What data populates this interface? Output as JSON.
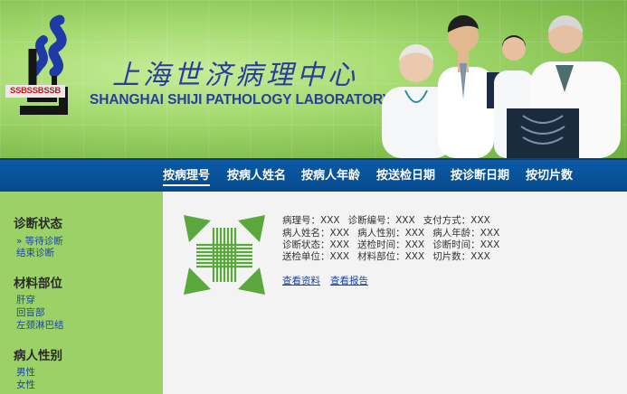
{
  "banner": {
    "logo_text": "SSBSSBSSB",
    "title_cn": "上海世济病理中心",
    "title_en": "SHANGHAI SHIJI PATHOLOGY LABORATORY"
  },
  "nav": {
    "items": [
      "按病理号",
      "按病人姓名",
      "按病人年龄",
      "按送检日期",
      "按诊断日期",
      "按切片数"
    ],
    "active": "按病理号"
  },
  "sidebar": {
    "sections": [
      {
        "heading": "诊断状态",
        "items": [
          "» 等待诊断",
          "结束诊断"
        ]
      },
      {
        "heading": "材料部位",
        "items": [
          "肝穿",
          "回盲部",
          "左颈淋巴结"
        ]
      },
      {
        "heading": "病人性别",
        "items": [
          "男性",
          "女性"
        ]
      }
    ]
  },
  "record": {
    "line1": [
      "病理号：XXX",
      "诊断编号：XXX",
      "支付方式：XXX"
    ],
    "line2": [
      "病人姓名：XXX",
      "病人性别：XXX",
      "病人年龄：XXX"
    ],
    "line3": [
      "诊断状态：XXX",
      "送检时间：XXX",
      "诊断时间：XXX"
    ],
    "line4": [
      "送检单位：XXX",
      "材料部位：XXX",
      "切片数：XXX"
    ],
    "view_data": "查看资料",
    "view_report": "查看报告"
  },
  "colors": {
    "nav_bg": "#0b5ba7",
    "sidebar_bg": "#9bd166",
    "logo_blue": "#1f3aa6",
    "brand_text": "#2a3d9e",
    "thumb_green": "#5aa83c"
  }
}
